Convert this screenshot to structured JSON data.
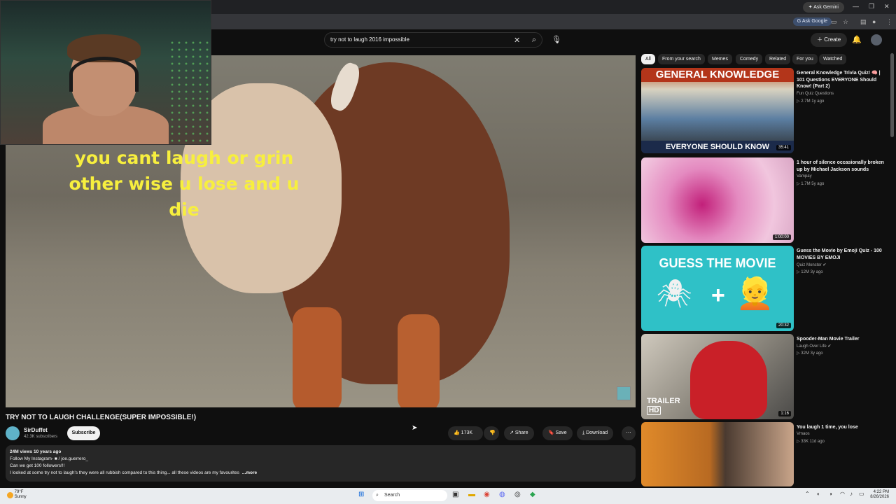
{
  "browser": {
    "ask_gemini": "Ask Gemini",
    "ask_google": "Ask Google"
  },
  "header": {
    "search_query": "try not to laugh 2016 impossible",
    "create_label": "Create"
  },
  "video": {
    "overlay_text": "you cant laugh or grin other wise u lose and u die",
    "title": "TRY NOT TO LAUGH CHALLENGE(SUPER IMPOSSIBLE!)",
    "channel": "SirDuffet",
    "subscribers": "42.3K subscribers",
    "subscribe_label": "Subscribe",
    "likes": "173K",
    "share_label": "Share",
    "save_label": "Save",
    "download_label": "Download",
    "views_age": "24M views  10 years ago",
    "desc_line1": "Follow My Instagram- ■ / joe.guerrero_",
    "desc_line2": "Can we get 100 followers!!!",
    "desc_line3": "I looked at some try not to laugh's they were all rubbish compared to this thing... all these videos are my favourites",
    "more_label": "...more"
  },
  "chips": [
    "All",
    "From your search",
    "Memes",
    "Comedy",
    "Related",
    "For you",
    "Watched"
  ],
  "recommendations": [
    {
      "title": "General Knowledge Trivia Quiz! 🧠 | 101 Questions EVERYONE Should Know! (Part 2)",
      "channel": "Fun Quiz Questions",
      "meta": "▷ 2.7M  1y ago",
      "duration": "35:41",
      "thumb_top": "GENERAL KNOWLEDGE",
      "thumb_bottom": "EVERYONE SHOULD KNOW"
    },
    {
      "title": "1 hour of silence occasionally broken up by Michael Jackson sounds",
      "channel": "Vampay",
      "meta": "▷ 1.7M  5y ago",
      "duration": "1:00:00"
    },
    {
      "title": "Guess the Movie by Emoji Quiz - 100 MOVIES BY EMOJI",
      "channel": "Quiz Monster ✔",
      "meta": "▷ 12M  3y ago",
      "duration": "20:32",
      "thumb_top": "GUESS THE MOVIE"
    },
    {
      "title": "Spooder-Man Movie Trailer",
      "channel": "Laugh Over Life ✔",
      "meta": "▷ 32M  3y ago",
      "duration": "1:16",
      "thumb_top": "TRAILER",
      "thumb_badge": "HD"
    },
    {
      "title": "You laugh 1 time, you lose",
      "channel": "Vmaos",
      "meta": "▷ 33K  11d ago"
    }
  ],
  "taskbar": {
    "search": "Search",
    "weather_temp": "79°F",
    "weather_desc": "Sunny",
    "time": "4:22 PM",
    "date": "8/26/2026"
  }
}
